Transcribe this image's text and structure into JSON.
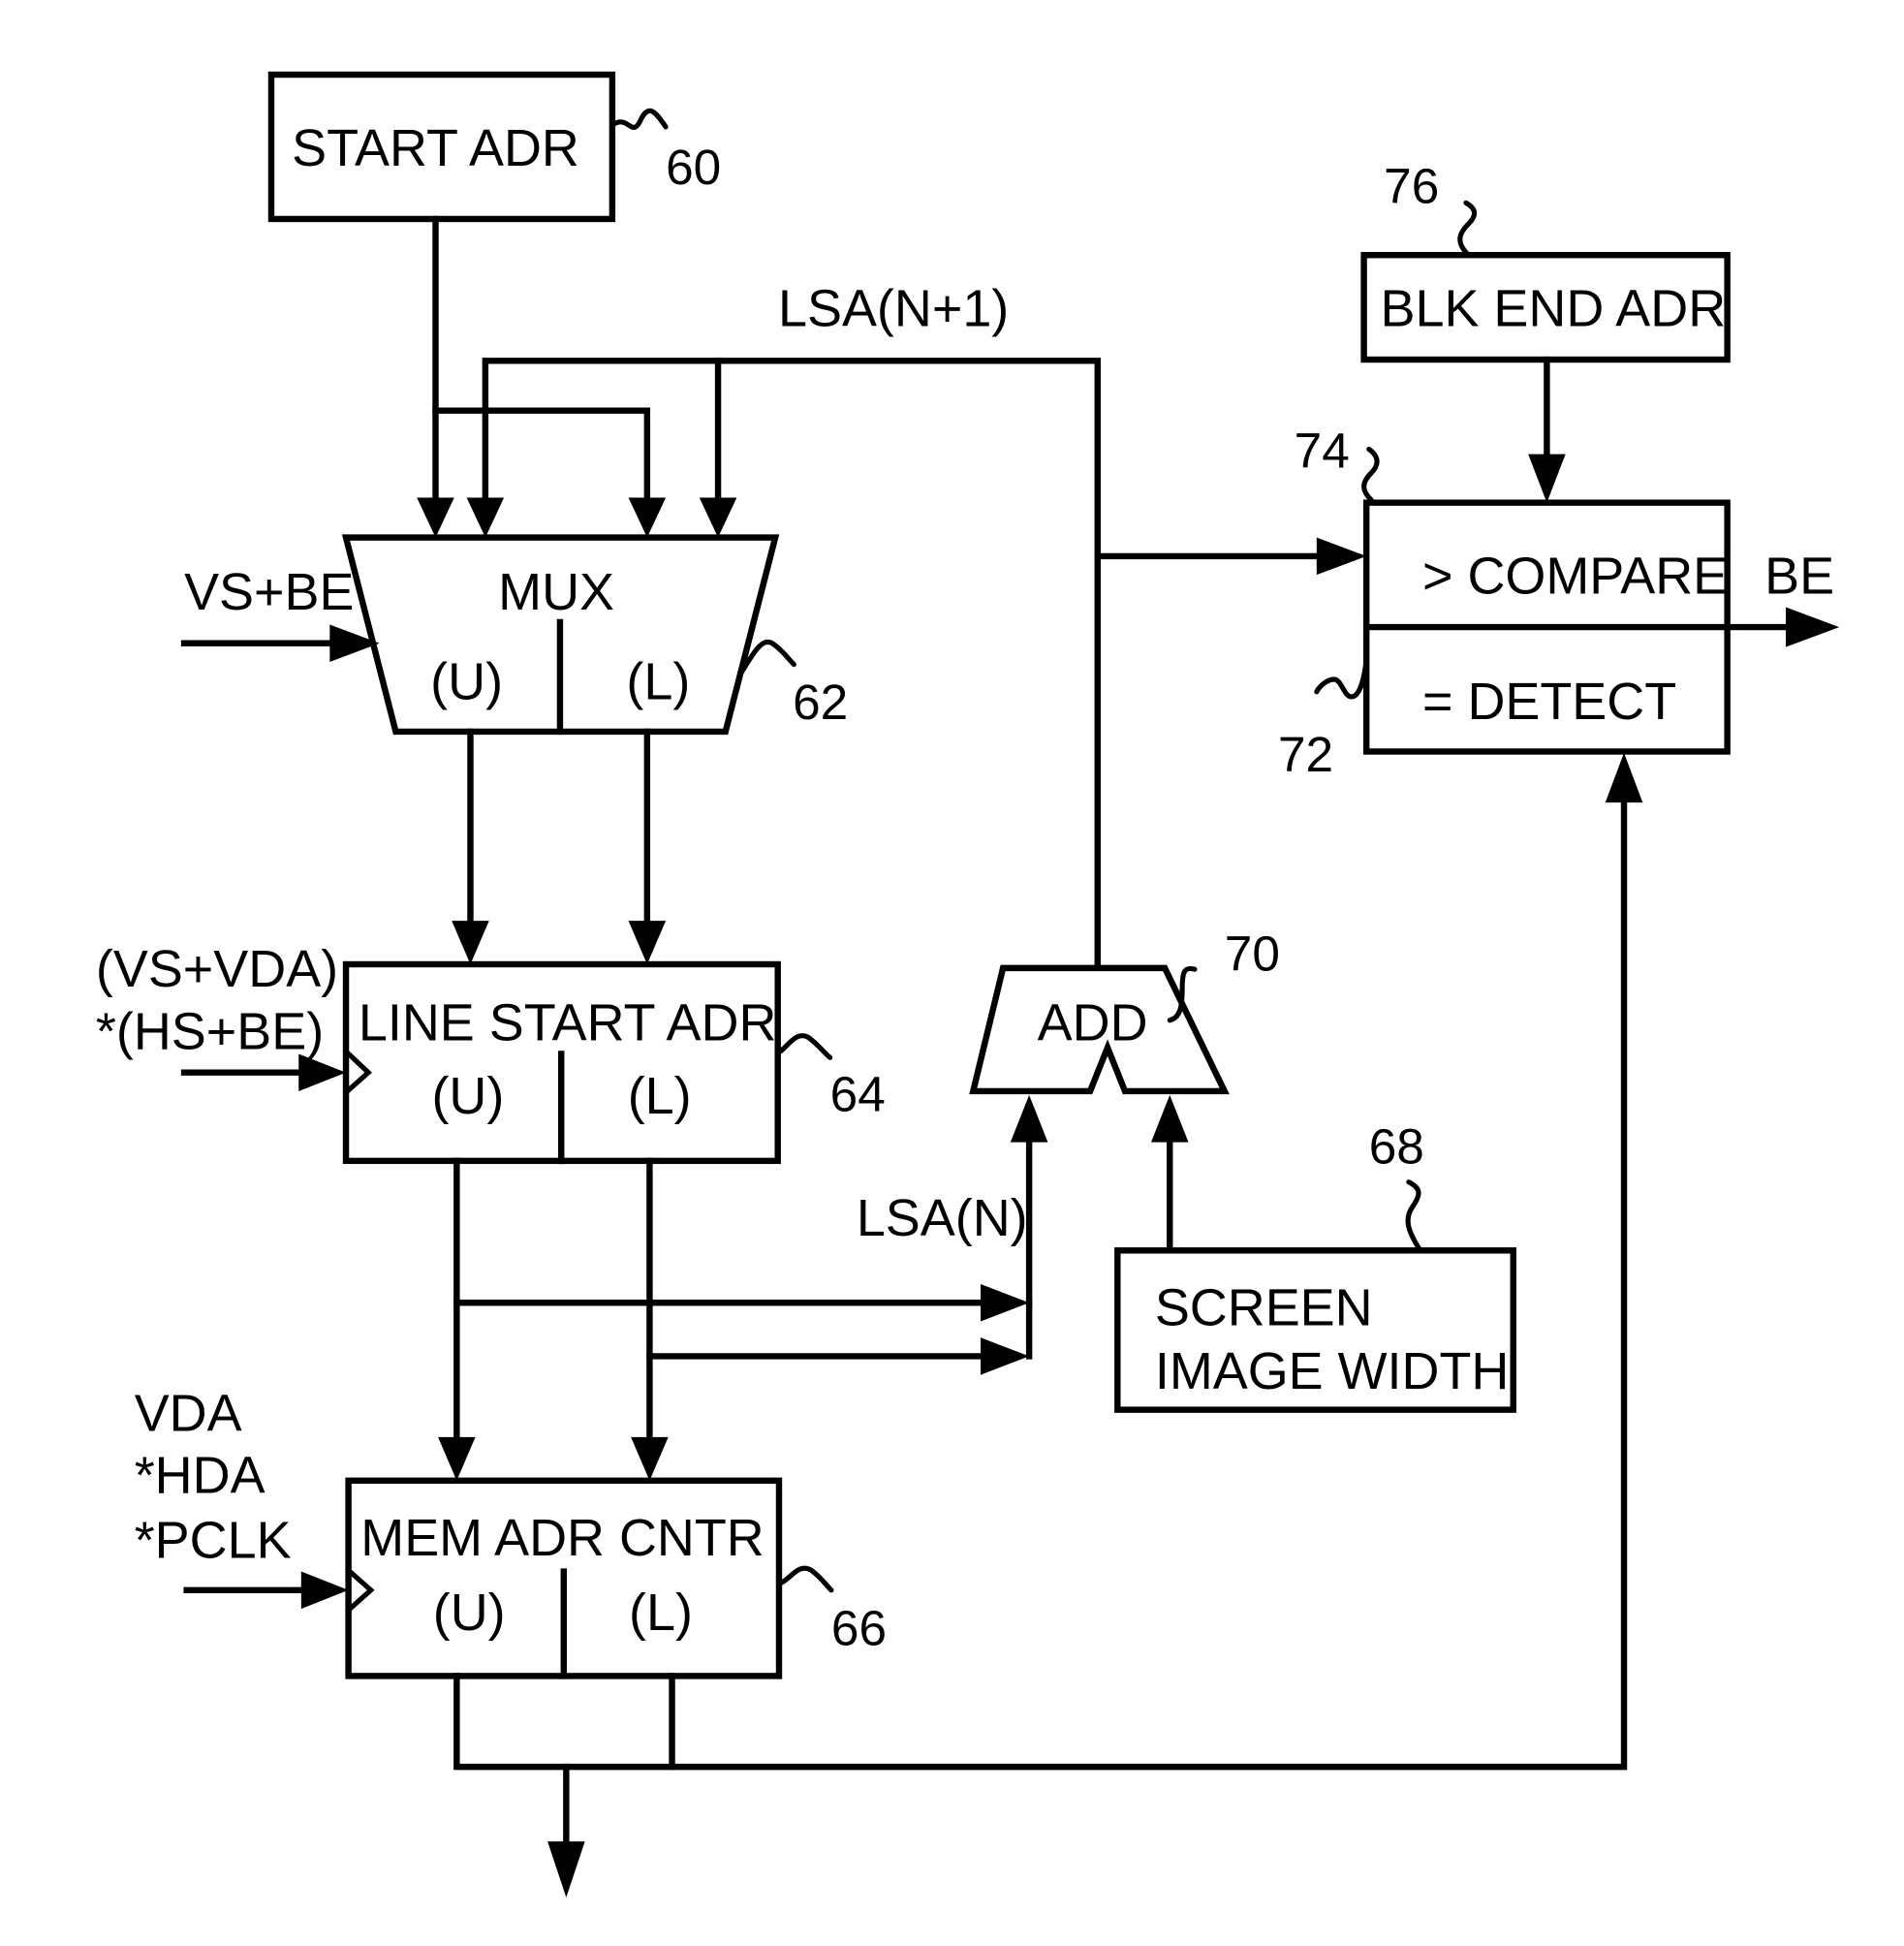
{
  "figure": {
    "blocks": {
      "start_adr": {
        "label": "START ADR",
        "ref": "60"
      },
      "mux": {
        "label": "MUX",
        "upper": "(U)",
        "lower": "(L)",
        "ref": "62"
      },
      "line_start_adr": {
        "label": "LINE START ADR",
        "upper": "(U)",
        "lower": "(L)",
        "ref": "64"
      },
      "mem_adr_cntr": {
        "label": "MEM ADR CNTR",
        "upper": "(U)",
        "lower": "(L)",
        "ref": "66"
      },
      "screen_image_width": {
        "line1": "SCREEN",
        "line2": "IMAGE WIDTH",
        "ref": "68"
      },
      "add": {
        "label": "ADD",
        "ref": "70"
      },
      "compare": {
        "label": "> COMPARE",
        "ref": "74"
      },
      "detect": {
        "label": "= DETECT",
        "ref": "72"
      },
      "blk_end_adr": {
        "label": "BLK END ADR",
        "ref": "76"
      }
    },
    "signals": {
      "lsa_next": "LSA(N+1)",
      "lsa_n": "LSA(N)",
      "mux_select": "VS+BE",
      "line_clock_1": "(VS+VDA)",
      "line_clock_2": "*(HS+BE)",
      "mem_clock_1": "VDA",
      "mem_clock_2": "*HDA",
      "mem_clock_3": "*PCLK",
      "be_out": "BE"
    }
  }
}
